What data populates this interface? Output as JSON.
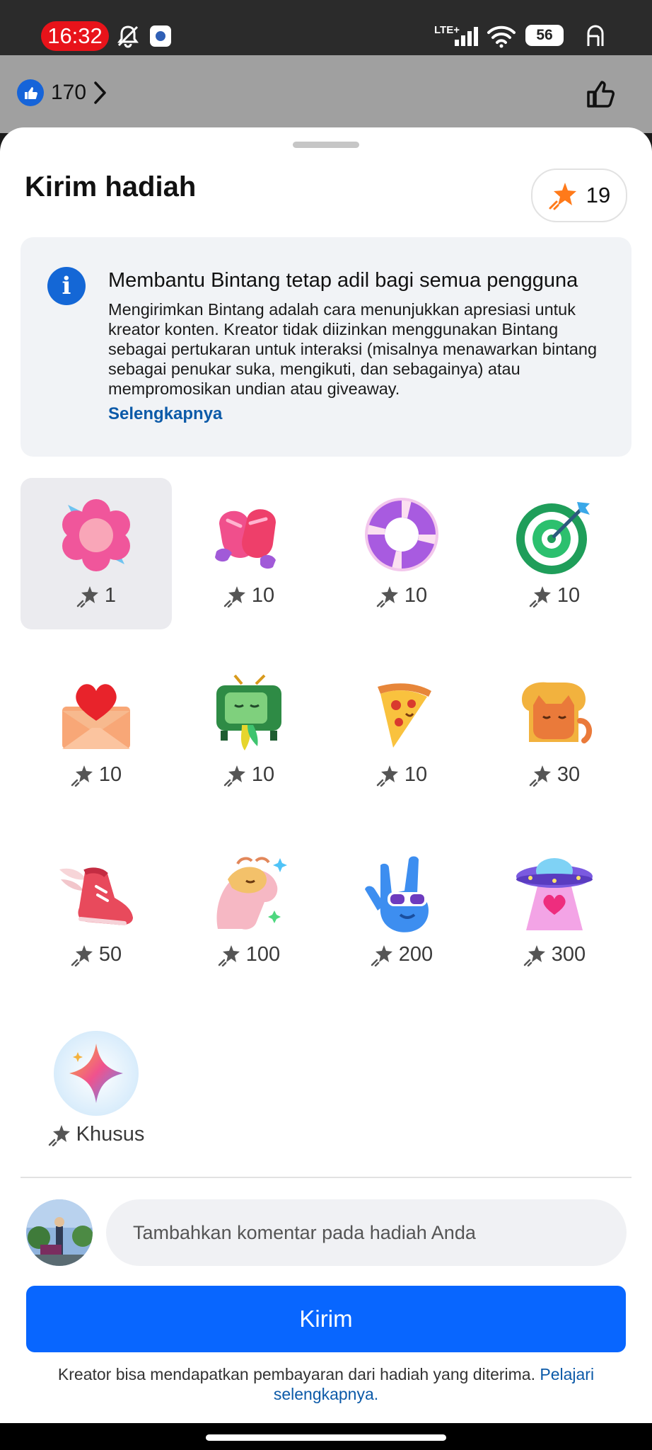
{
  "status_bar": {
    "time": "16:32",
    "network": "LTE+",
    "battery": "56"
  },
  "background": {
    "like_count": "170"
  },
  "sheet": {
    "title": "Kirim hadiah",
    "star_balance": "19",
    "info": {
      "title": "Membantu Bintang tetap adil bagi semua pengguna",
      "body": "Mengirimkan Bintang adalah cara menunjukkan apresiasi untuk kreator konten. Kreator tidak diizinkan menggunakan Bintang sebagai pertukaran untuk interaksi (misalnya menawarkan bintang sebagai penukar suka, mengikuti, dan sebagainya) atau mempromosikan undian atau giveaway.",
      "link": "Selengkapnya"
    },
    "gifts": [
      {
        "name": "flower",
        "price": "1",
        "selected": true
      },
      {
        "name": "mittens",
        "price": "10"
      },
      {
        "name": "lifebuoy",
        "price": "10"
      },
      {
        "name": "target",
        "price": "10"
      },
      {
        "name": "love-letter",
        "price": "10"
      },
      {
        "name": "tv",
        "price": "10"
      },
      {
        "name": "pizza",
        "price": "10"
      },
      {
        "name": "bread-cat",
        "price": "30"
      },
      {
        "name": "winged-sneaker",
        "price": "50"
      },
      {
        "name": "dragon",
        "price": "100"
      },
      {
        "name": "rock-hand",
        "price": "200"
      },
      {
        "name": "ufo",
        "price": "300"
      },
      {
        "name": "sparkle",
        "price": "Khusus"
      }
    ],
    "comment_placeholder": "Tambahkan komentar pada hadiah Anda",
    "send_label": "Kirim",
    "footer_text": "Kreator bisa mendapatkan pembayaran dari hadiah yang diterima.",
    "footer_link": "Pelajari selengkapnya."
  },
  "colors": {
    "primary": "#0866ff",
    "link": "#0c5aa8",
    "info_icon": "#1467d6",
    "star": "#ff7a1a"
  }
}
